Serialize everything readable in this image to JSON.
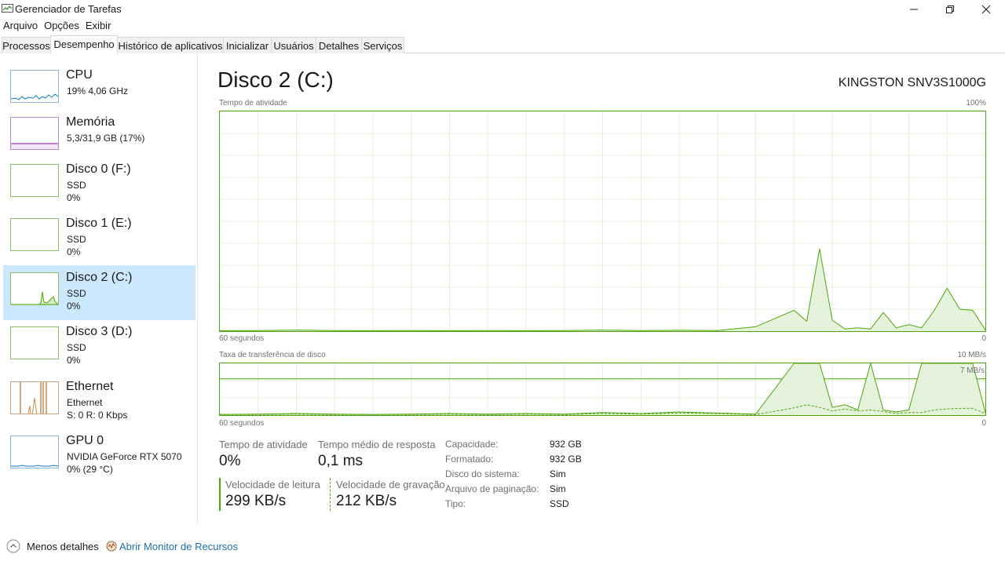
{
  "window": {
    "title": "Gerenciador de Tarefas"
  },
  "menu": [
    "Arquivo",
    "Opções",
    "Exibir"
  ],
  "tabs": [
    {
      "label": "Processos",
      "active": false
    },
    {
      "label": "Desempenho",
      "active": true
    },
    {
      "label": "Histórico de aplicativos",
      "active": false
    },
    {
      "label": "Inicializar",
      "active": false
    },
    {
      "label": "Usuários",
      "active": false
    },
    {
      "label": "Detalhes",
      "active": false
    },
    {
      "label": "Serviços",
      "active": false
    }
  ],
  "sidebar": {
    "items": [
      {
        "title": "CPU",
        "line1": "19%  4,06 GHz",
        "line2": "",
        "color": "#117dbb",
        "active": false
      },
      {
        "title": "Memória",
        "line1": "5,3/31,9 GB (17%)",
        "line2": "",
        "color": "#8b12ae",
        "active": false
      },
      {
        "title": "Disco 0 (F:)",
        "line1": "SSD",
        "line2": "0%",
        "color": "#4da60c",
        "active": false
      },
      {
        "title": "Disco 1 (E:)",
        "line1": "SSD",
        "line2": "0%",
        "color": "#4da60c",
        "active": false
      },
      {
        "title": "Disco 2 (C:)",
        "line1": "SSD",
        "line2": "0%",
        "color": "#4da60c",
        "active": true
      },
      {
        "title": "Disco 3 (D:)",
        "line1": "SSD",
        "line2": "0%",
        "color": "#4da60c",
        "active": false
      },
      {
        "title": "Ethernet",
        "line1": "Ethernet",
        "line2": "S: 0  R: 0 Kbps",
        "color": "#a74f01",
        "active": false
      },
      {
        "title": "GPU 0",
        "line1": "NVIDIA GeForce RTX 5070",
        "line2": "0%  (29 °C)",
        "color": "#117dbb",
        "active": false
      }
    ]
  },
  "main": {
    "title": "Disco 2 (C:)",
    "device": "KINGSTON SNV3S1000G",
    "activity_chart": {
      "label": "Tempo de atividade",
      "max_label": "100%",
      "time_label": "60 segundos",
      "zero_label": "0"
    },
    "transfer_chart": {
      "label": "Taxa de transferência de disco",
      "max_label": "10 MB/s",
      "mid_label": "7 MB/s",
      "time_label": "60 segundos",
      "zero_label": "0"
    }
  },
  "chart_data": [
    {
      "type": "area",
      "title": "Tempo de atividade",
      "xlabel": "60 segundos",
      "ylim": [
        0,
        100
      ],
      "unit": "%",
      "x": [
        60,
        57,
        54,
        51,
        48,
        45,
        42,
        39,
        36,
        33,
        30,
        27,
        24,
        21,
        18,
        15,
        14,
        13,
        12,
        11,
        10,
        9,
        8,
        7,
        6,
        5,
        4,
        3,
        2,
        1,
        0
      ],
      "series": [
        {
          "values": [
            0.2,
            0.3,
            0.5,
            0.3,
            0.2,
            0.3,
            0.2,
            0.3,
            0.2,
            0.3,
            0.5,
            0.3,
            0.4,
            0.3,
            2,
            9.5,
            4.5,
            37.5,
            5,
            1,
            1.5,
            1,
            8.5,
            1.5,
            3,
            1.5,
            9.5,
            19.5,
            10,
            9.5,
            0.5
          ]
        }
      ]
    },
    {
      "type": "line",
      "title": "Taxa de transferência de disco",
      "xlabel": "60 segundos",
      "ylim": [
        0,
        10
      ],
      "unit": "MB/s",
      "x": [
        60,
        57,
        54,
        51,
        48,
        45,
        42,
        39,
        36,
        33,
        30,
        27,
        24,
        21,
        18,
        15,
        14,
        13,
        12,
        11,
        10,
        9,
        8,
        7,
        6,
        5,
        4,
        3,
        2,
        1,
        0
      ],
      "series": [
        {
          "values": [
            0.1,
            0.2,
            0.3,
            0.2,
            0.1,
            0.2,
            0.3,
            0.2,
            0.3,
            0.2,
            0.5,
            0.3,
            0.6,
            0.4,
            0.2,
            10,
            10,
            10,
            1.5,
            2,
            1,
            10,
            1,
            0.6,
            1,
            10,
            10,
            10,
            10,
            10,
            0.5
          ]
        },
        {
          "values": [
            0.1,
            0.1,
            0.2,
            0.1,
            0.1,
            0.1,
            0.2,
            0.1,
            0.2,
            0.1,
            0.3,
            0.2,
            0.4,
            0.3,
            0.1,
            1.4,
            2,
            1.5,
            0.8,
            1.2,
            0.8,
            1,
            0.7,
            0.3,
            0.5,
            0.5,
            1,
            1.2,
            1.3,
            1.3,
            0.3
          ]
        }
      ]
    }
  ],
  "stats": {
    "activity_label": "Tempo de atividade",
    "activity_value": "0%",
    "response_label": "Tempo médio de resposta",
    "response_value": "0,1 ms",
    "read_label": "Velocidade de leitura",
    "read_value": "299 KB/s",
    "write_label": "Velocidade de gravação",
    "write_value": "212 KB/s"
  },
  "info": [
    {
      "label": "Capacidade:",
      "value": "932 GB"
    },
    {
      "label": "Formatado:",
      "value": "932 GB"
    },
    {
      "label": "Disco do sistema:",
      "value": "Sim"
    },
    {
      "label": "Arquivo de paginação:",
      "value": "Sim"
    },
    {
      "label": "Tipo:",
      "value": "SSD"
    }
  ],
  "footer": {
    "fewer_details": "Menos detalhes",
    "resource_monitor": "Abrir Monitor de Recursos"
  },
  "colors": {
    "disk": "#4da60c",
    "disk_fill": "#e6f3dc",
    "selected": "#cce8ff",
    "link": "#1f6fa8"
  }
}
